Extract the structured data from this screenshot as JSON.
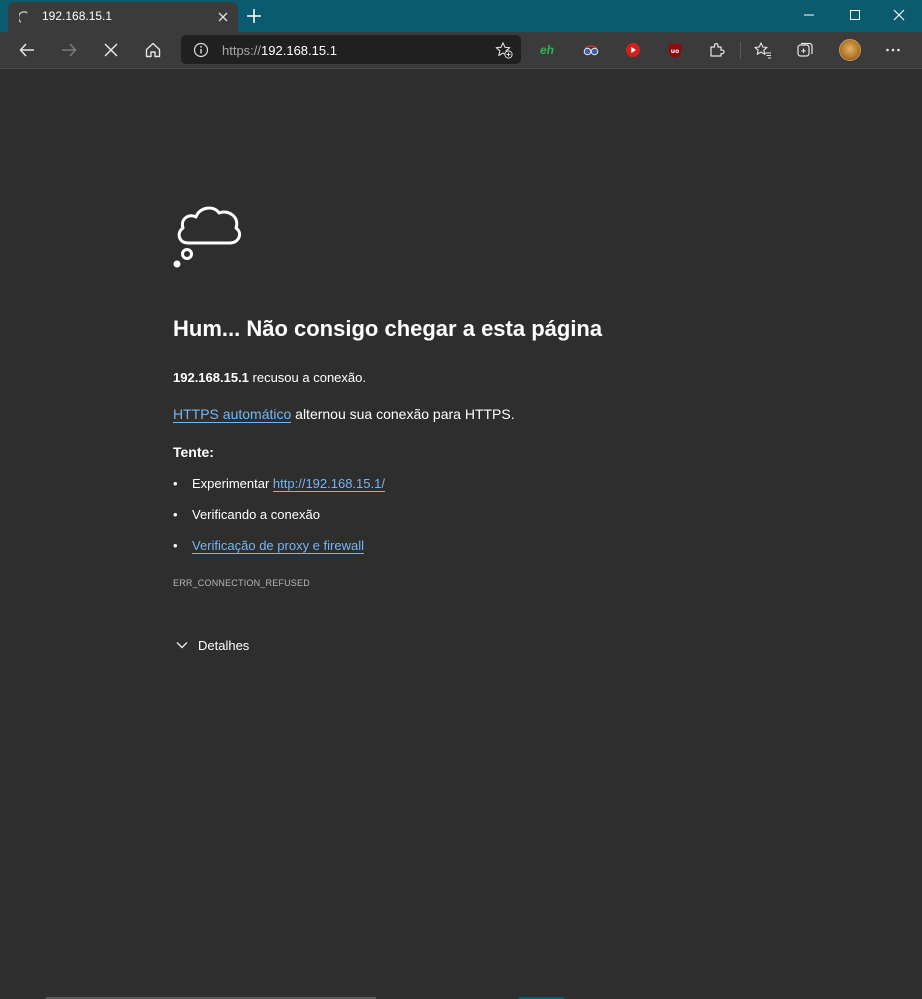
{
  "browser": {
    "tab": {
      "title": "192.168.15.1"
    },
    "address_bar": {
      "scheme": "https://",
      "host": "192.168.15.1"
    },
    "extensions": [
      "eh",
      "binoculars-icon",
      "youtube-icon",
      "ublock-icon"
    ],
    "accent": "#0b5b6e",
    "link_color": "#78b4ef"
  },
  "error_page": {
    "heading": "Hum... Não consigo chegar a esta página",
    "host": "192.168.15.1",
    "refused_text": " recusou a conexão.",
    "https_link": "HTTPS automático",
    "https_text": " alternou sua conexão para HTTPS.",
    "try_label": "Tente:",
    "suggestions": {
      "s1_prefix": "Experimentar ",
      "s1_link": "http://192.168.15.1/",
      "s2": "Verificando a conexão",
      "s3_link": "Verificação de proxy e firewall"
    },
    "error_code": "ERR_CONNECTION_REFUSED",
    "details_label": "Detalhes"
  }
}
